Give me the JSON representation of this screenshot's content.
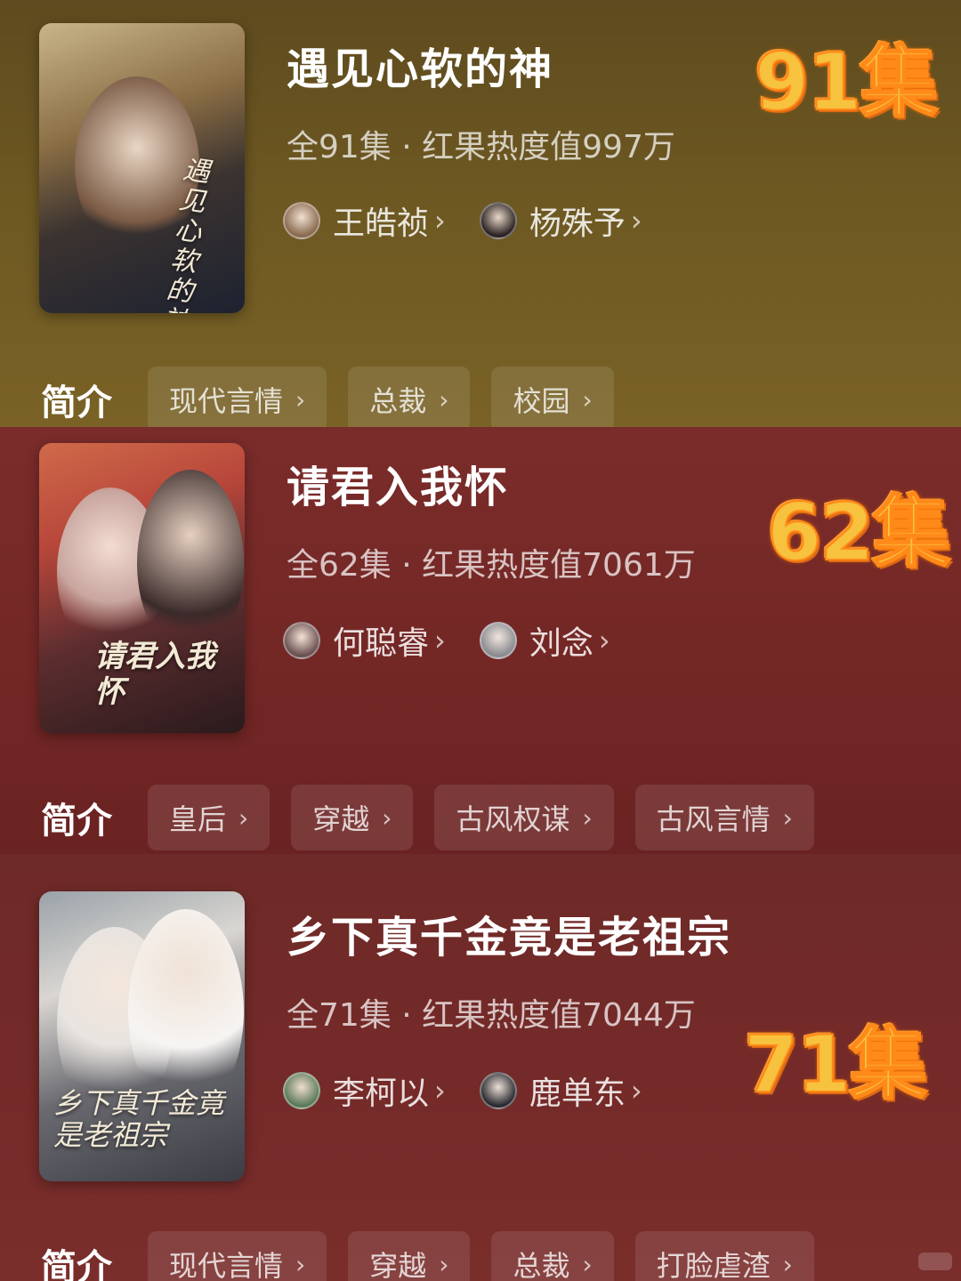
{
  "shows": [
    {
      "title": "遇见心软的神",
      "meta": "全91集 · 红果热度值997万",
      "badge": "91集",
      "poster_title": "遇见心软的神",
      "actors": [
        {
          "name": "王皓祯"
        },
        {
          "name": "杨殊予"
        }
      ],
      "intro_label": "简介",
      "tags": [
        "现代言情",
        "总裁",
        "校园"
      ]
    },
    {
      "title": "请君入我怀",
      "meta": "全62集 · 红果热度值7061万",
      "badge": "62集",
      "poster_title": "请君入我怀",
      "actors": [
        {
          "name": "何聪睿"
        },
        {
          "name": "刘念"
        }
      ],
      "intro_label": "简介",
      "tags": [
        "皇后",
        "穿越",
        "古风权谋",
        "古风言情"
      ]
    },
    {
      "title": "乡下真千金竟是老祖宗",
      "meta": "全71集 · 红果热度值7044万",
      "badge": "71集",
      "poster_title": "乡下真千金竟是老祖宗",
      "actors": [
        {
          "name": "李柯以"
        },
        {
          "name": "鹿单东"
        }
      ],
      "intro_label": "简介",
      "tags": [
        "现代言情",
        "穿越",
        "总裁",
        "打脸虐渣"
      ]
    }
  ],
  "chevron": "›",
  "colors": {
    "badge": "#f7c23e",
    "badge_glow": "#ff7a00"
  }
}
